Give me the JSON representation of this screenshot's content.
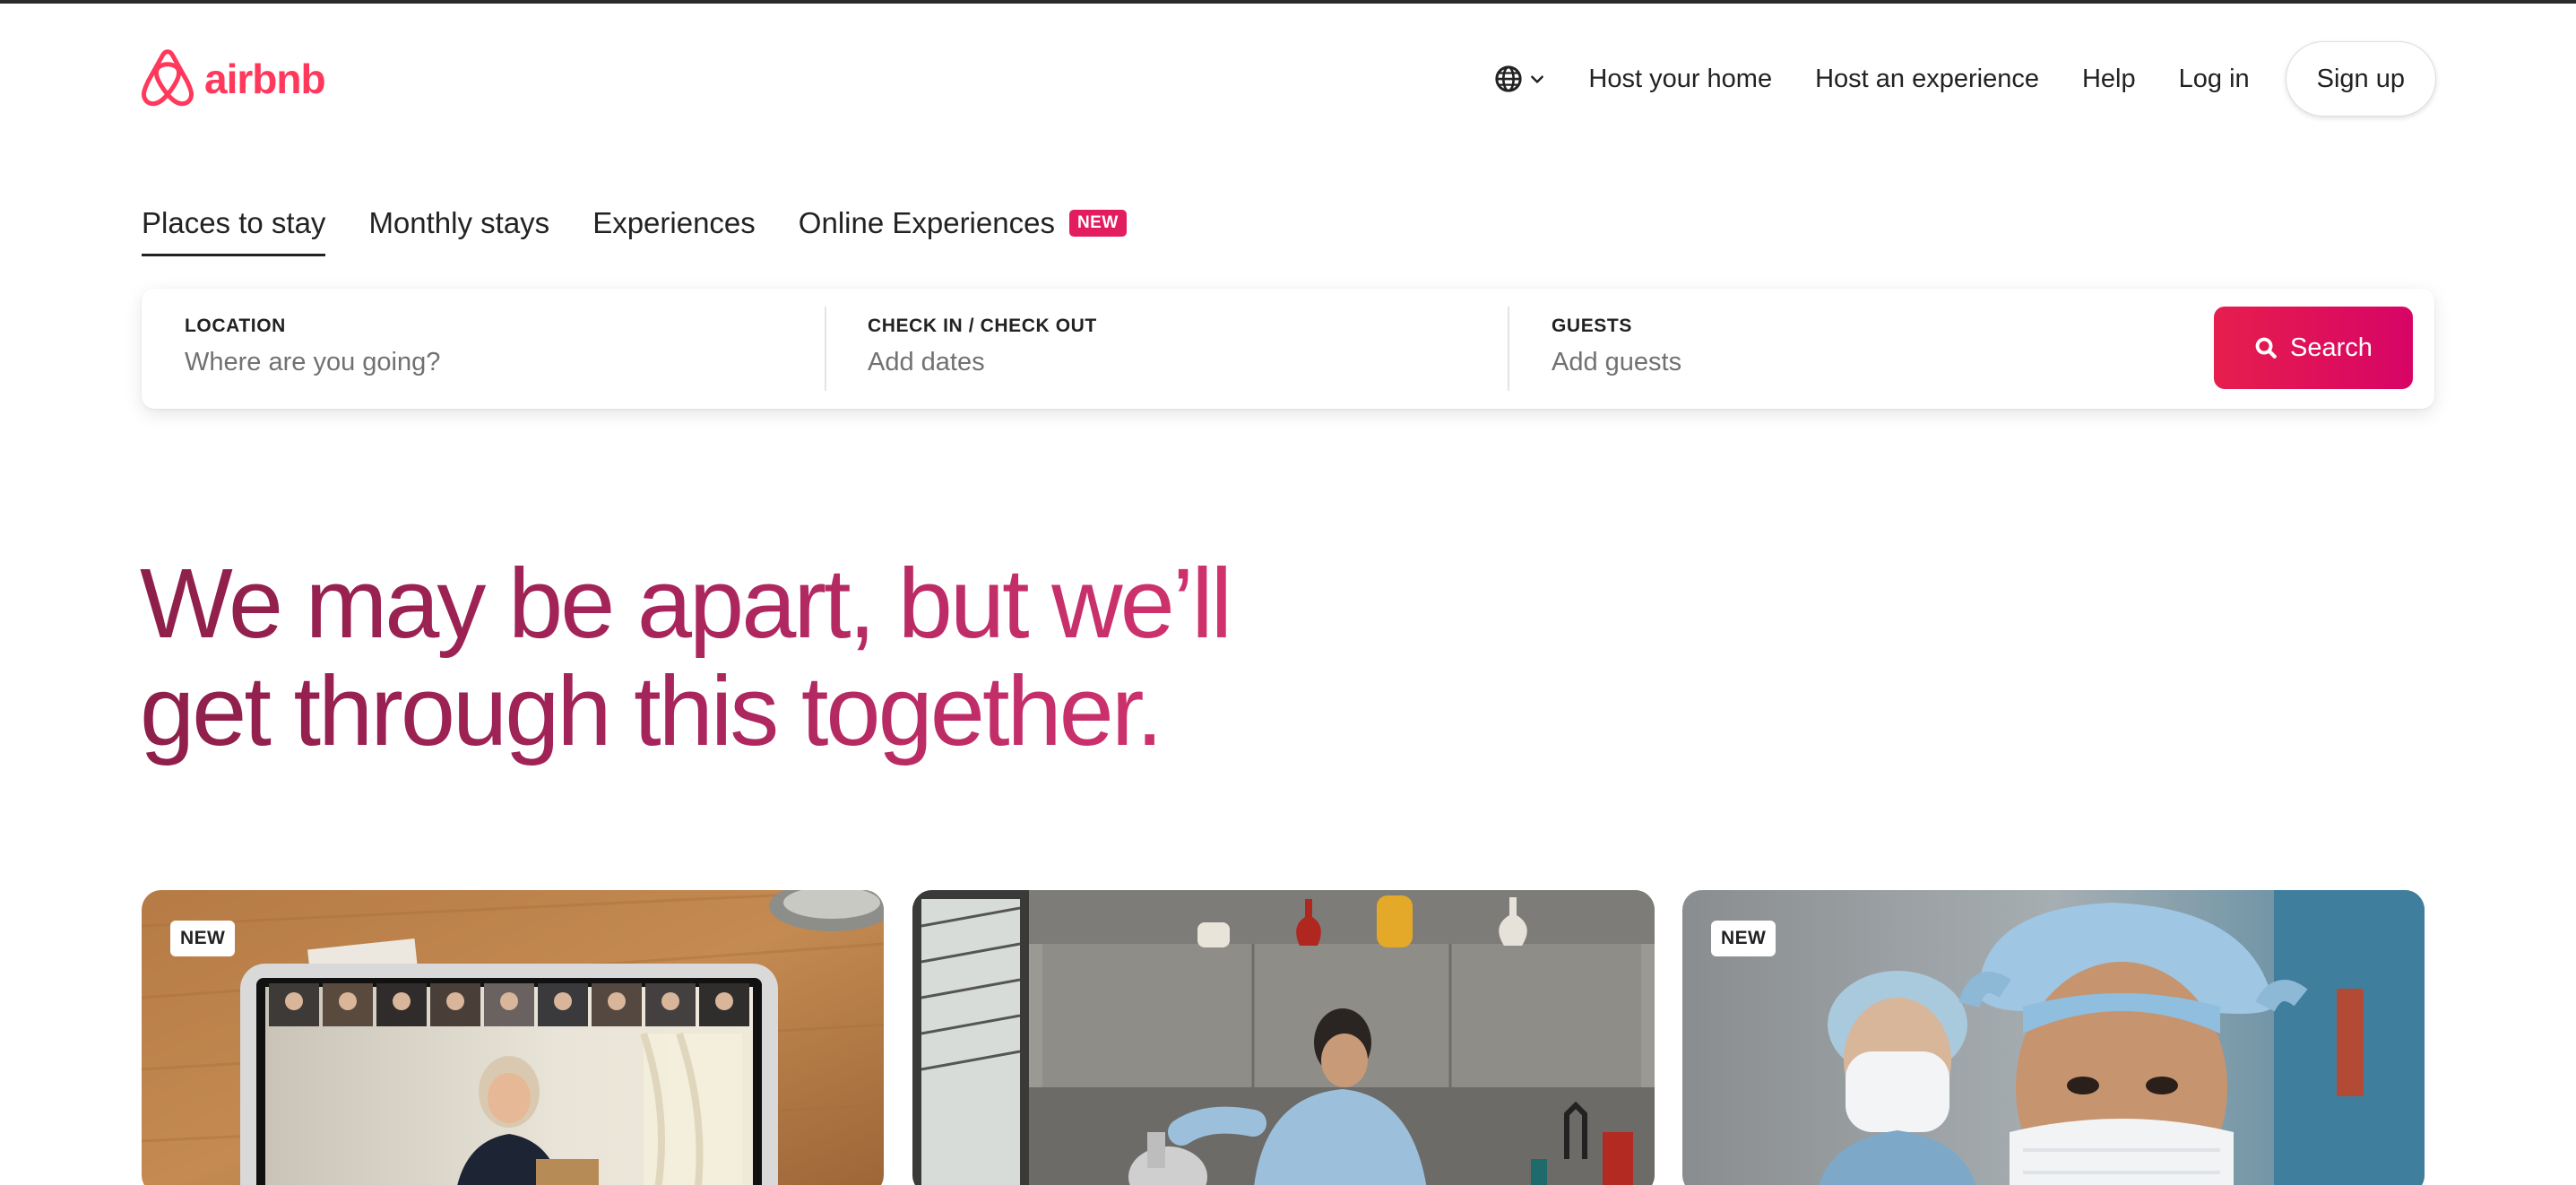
{
  "brand": {
    "name": "airbnb",
    "color": "#FF385C",
    "logo_icon": "airbnb-belo-icon"
  },
  "header": {
    "language_icon": "globe-icon",
    "menu_icon": "chevron-down-icon",
    "links": [
      "Host your home",
      "Host an experience",
      "Help",
      "Log in"
    ],
    "signup_label": "Sign up"
  },
  "tabs": [
    {
      "label": "Places to stay",
      "active": true
    },
    {
      "label": "Monthly stays",
      "active": false
    },
    {
      "label": "Experiences",
      "active": false
    },
    {
      "label": "Online Experiences",
      "active": false,
      "badge": "NEW"
    }
  ],
  "search": {
    "location_label": "LOCATION",
    "location_placeholder": "Where are you going?",
    "dates_label": "CHECK IN / CHECK OUT",
    "dates_placeholder": "Add dates",
    "guests_label": "GUESTS",
    "guests_placeholder": "Add guests",
    "button_label": "Search",
    "button_icon": "search-icon",
    "button_color": "#E61E4D"
  },
  "hero": {
    "line1": "We may be apart, but we’ll",
    "line2": "get through this together.",
    "gradient_start": "#8E1F4A",
    "gradient_end": "#D8346E"
  },
  "cards": [
    {
      "badge": "NEW",
      "image": "online-experience-video-call-photo"
    },
    {
      "badge": "",
      "image": "man-cooking-in-kitchen-photo"
    },
    {
      "badge": "NEW",
      "image": "healthcare-workers-masks-photo"
    }
  ]
}
